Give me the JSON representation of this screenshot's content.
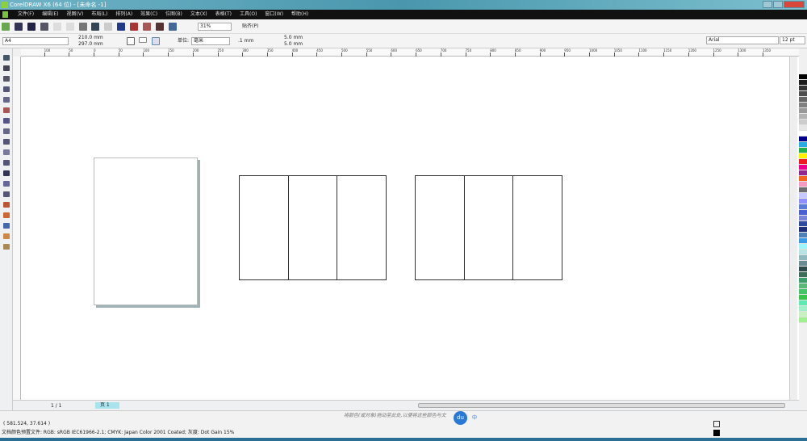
{
  "app": {
    "title": "CorelDRAW X6 (64 位) - [未命名 -1]"
  },
  "menu": [
    "文件(F)",
    "编辑(E)",
    "视图(V)",
    "布局(L)",
    "排列(A)",
    "效果(C)",
    "位图(B)",
    "文本(X)",
    "表格(T)",
    "工具(O)",
    "窗口(W)",
    "帮助(H)"
  ],
  "toolbar": {
    "zoom": "31%",
    "snap": "贴齐(P)"
  },
  "propbar": {
    "page_size": "A4",
    "width": "210.0 mm",
    "height": "297.0 mm",
    "units_label": "单位:",
    "units": "毫米",
    "nudge": ".1 mm",
    "dup_x": "5.0 mm",
    "dup_y": "5.0 mm",
    "font": "Arial",
    "font_size": "12 pt"
  },
  "ruler": {
    "labels": [
      "100",
      "50",
      "0",
      "50",
      "100",
      "150",
      "200",
      "250",
      "300",
      "350",
      "400",
      "450",
      "500",
      "550",
      "600",
      "650",
      "700",
      "750",
      "800",
      "850",
      "900",
      "950",
      "1000",
      "1050",
      "1100",
      "1150",
      "1200",
      "1250",
      "1300",
      "1350"
    ]
  },
  "pages": {
    "counter": "1 / 1",
    "tab": "页 1"
  },
  "hint": "将颜色(或对象)拖动至此处,以便将这些颜色与文",
  "ime": {
    "logo": "du",
    "lang": "中"
  },
  "status": {
    "coords": "( 581.524, 37.614 )",
    "profile": "文档颜色预置文件: RGB: sRGB IEC61966-2.1; CMYK: Japan Color 2001 Coated; 灰度: Dot Gain 15%"
  },
  "palette": [
    "#000000",
    "#1c1c1c",
    "#333333",
    "#4d4d4d",
    "#666666",
    "#808080",
    "#999999",
    "#b3b3b3",
    "#cccccc",
    "#e6e6e6",
    "#ffffff",
    "#00008b",
    "#29abe2",
    "#22b14c",
    "#fff200",
    "#ed1c24",
    "#ec008c",
    "#92278f",
    "#f26522",
    "#f49ac1",
    "#6d6e71",
    "#c7c8ff",
    "#8f8fff",
    "#5b7bd6",
    "#4a5fd0",
    "#7b82d9",
    "#2e4a9e",
    "#1f2f7a",
    "#4f7fb8",
    "#3a9ae8",
    "#9ff5ff",
    "#b8e3e3",
    "#8fb8c0",
    "#6a8a94",
    "#2f4a4a",
    "#3e6e5a",
    "#3f9e6e",
    "#5cb87a",
    "#45c46a",
    "#3ac34a",
    "#5fe8b0",
    "#9ff0c8",
    "#c8f0c0",
    "#a0f090"
  ]
}
